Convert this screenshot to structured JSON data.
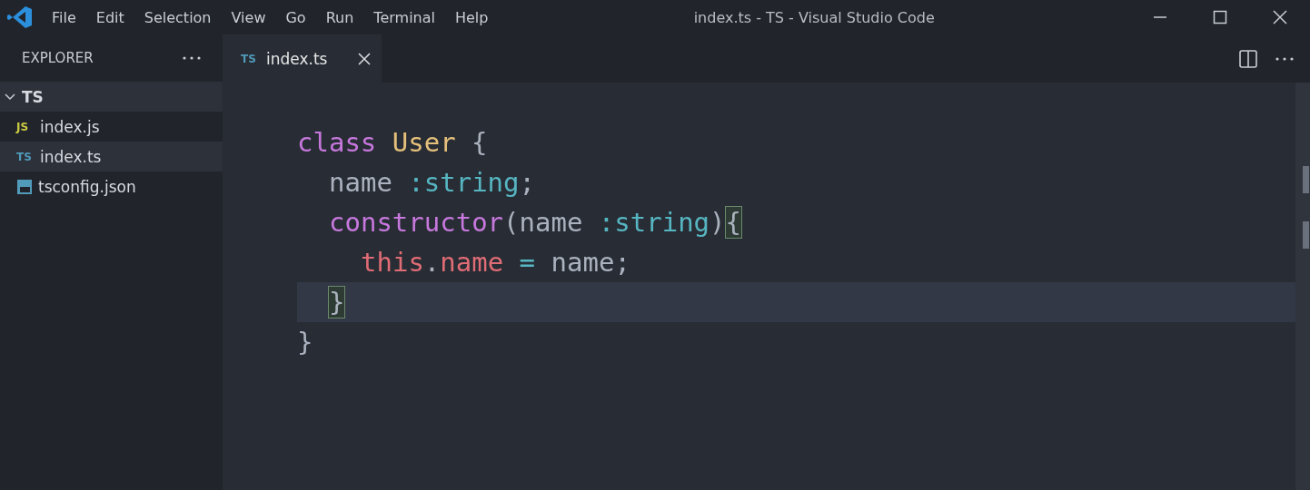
{
  "menu": [
    "File",
    "Edit",
    "Selection",
    "View",
    "Go",
    "Run",
    "Terminal",
    "Help"
  ],
  "window": {
    "title": "index.ts - TS - Visual Studio Code"
  },
  "sidebar": {
    "title": "EXPLORER",
    "folder": {
      "name": "TS",
      "expanded": true,
      "selected": true,
      "children": [
        {
          "name": "index.js",
          "kind": "js",
          "badge": "JS",
          "selected": false
        },
        {
          "name": "index.ts",
          "kind": "ts",
          "badge": "TS",
          "selected": true
        },
        {
          "name": "tsconfig.json",
          "kind": "tsconfig",
          "selected": false
        }
      ]
    }
  },
  "tabs": [
    {
      "label": "index.ts",
      "badge": "TS",
      "selected": true
    }
  ],
  "editor": {
    "lines": [
      {
        "current": false,
        "tokens": [
          {
            "text": "class ",
            "kind": "keyword"
          },
          {
            "text": "User",
            "kind": "type"
          },
          {
            "text": " {",
            "kind": "plain"
          }
        ],
        "children": [
          {
            "current": false,
            "tokens": [
              {
                "text": "name ",
                "kind": "plain"
              },
              {
                "text": ":string",
                "kind": "typeref"
              },
              {
                "text": ";",
                "kind": "plain"
              }
            ]
          },
          {
            "current": false,
            "tokens": [
              {
                "text": "constructor",
                "kind": "keyword"
              },
              {
                "text": "(name ",
                "kind": "plain"
              },
              {
                "text": ":string",
                "kind": "typeref"
              },
              {
                "text": ")",
                "kind": "plain"
              },
              {
                "text": "{",
                "kind": "plain",
                "matched": true
              }
            ],
            "children": [
              {
                "current": false,
                "tokens": [
                  {
                    "text": "this",
                    "kind": "variable"
                  },
                  {
                    "text": ".",
                    "kind": "plain"
                  },
                  {
                    "text": "name",
                    "kind": "variable"
                  },
                  {
                    "text": " = ",
                    "kind": "operator"
                  },
                  {
                    "text": "name;",
                    "kind": "plain"
                  }
                ]
              }
            ]
          },
          {
            "current": true,
            "tokens": [
              {
                "text": "}",
                "kind": "plain",
                "matched": true
              }
            ]
          }
        ]
      },
      {
        "current": false,
        "tokens": [
          {
            "text": "}",
            "kind": "plain"
          }
        ]
      }
    ]
  }
}
